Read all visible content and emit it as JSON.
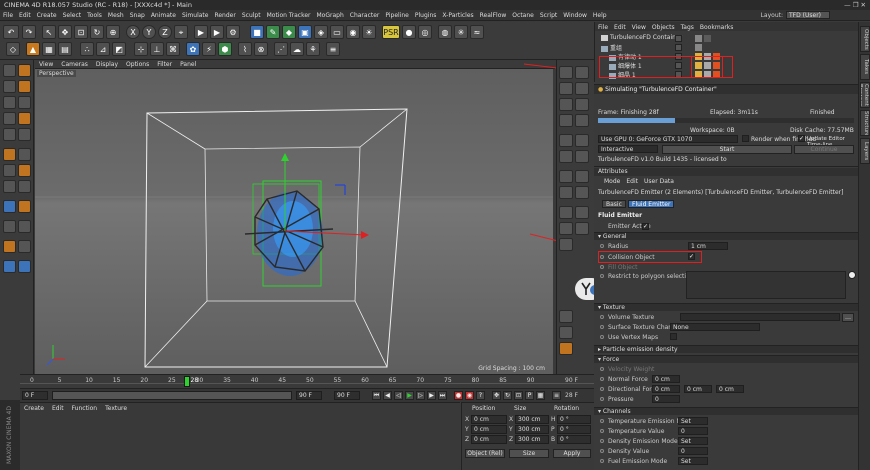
{
  "window": {
    "title": "CINEMA 4D R18.057 Studio (RC - R18) - [XXXc4d *] - Main",
    "controls": "—  ❐  ✕"
  },
  "menu": [
    "File",
    "Edit",
    "Create",
    "Select",
    "Tools",
    "Mesh",
    "Snap",
    "Animate",
    "Simulate",
    "Render",
    "Sculpt",
    "Motion Tracker",
    "MoGraph",
    "Character",
    "Pipeline",
    "Plugins",
    "X-Particles",
    "RealFlow",
    "Octane",
    "Script",
    "Window",
    "Help"
  ],
  "layout": {
    "label": "Layout:",
    "value": "TFD (User)"
  },
  "viewport": {
    "menu": [
      "View",
      "Cameras",
      "Display",
      "Options",
      "Filter",
      "Panel"
    ],
    "label": "Perspective",
    "grid_spacing": "Grid Spacing : 100 cm"
  },
  "timeline": {
    "ticks": [
      "0",
      "5",
      "10",
      "15",
      "20",
      "25",
      "30",
      "35",
      "40",
      "45",
      "50",
      "55",
      "60",
      "65",
      "70",
      "75",
      "80",
      "85",
      "90"
    ],
    "current_marker": "28",
    "end_frame": "90 F",
    "current_frame_display": "28 F",
    "start_field": "0 F",
    "end_field": "90 F",
    "end_field_a": "90 F"
  },
  "materials": {
    "menu": [
      "Create",
      "Edit",
      "Function",
      "Texture"
    ]
  },
  "logo": "MAXON CINEMA 4D",
  "coords": {
    "headers": [
      "Position",
      "Size",
      "Rotation"
    ],
    "rows": [
      {
        "axis": "X",
        "pos": "0 cm",
        "size": "300 cm",
        "rlabel": "H",
        "rot": "0 °"
      },
      {
        "axis": "Y",
        "pos": "0 cm",
        "size": "300 cm",
        "rlabel": "P",
        "rot": "0 °"
      },
      {
        "axis": "Z",
        "pos": "0 cm",
        "size": "300 cm",
        "rlabel": "B",
        "rot": "0 °"
      }
    ],
    "mode": "Object (Rel)",
    "size_mode": "Size",
    "apply": "Apply"
  },
  "objects": {
    "menu": [
      "File",
      "Edit",
      "View",
      "Objects",
      "Tags",
      "Bookmarks"
    ],
    "items": [
      {
        "name": "TurbulenceFD Container",
        "indent": 0
      },
      {
        "name": "重组",
        "indent": 0
      },
      {
        "name": "有律动 1",
        "indent": 1
      },
      {
        "name": "细爆体 1",
        "indent": 1
      },
      {
        "name": "细晶 1",
        "indent": 1
      }
    ]
  },
  "sidetabs": [
    "Objects",
    "Takes",
    "Content Browser",
    "Structure",
    "Layers"
  ],
  "sim": {
    "header": "Simulating \"TurbulenceFD Container\"",
    "frame": "Frame: Finishing 28f",
    "elapsed": "Elapsed: 3m11s",
    "finished": "Finished",
    "progress": 0.3,
    "workspace": "Workspace: 0B",
    "disk_cache": "Disk Cache: 77.57MB",
    "gpu": "Use GPU 0: GeForce GTX 1070",
    "render_when_finished": "Render when finished",
    "update_editor": "Update Editor Time-line",
    "mode": "Interactive",
    "start": "Start",
    "continue": "Continue",
    "version": "TurbulenceFD v1.0 Build 1435 - licensed to"
  },
  "attributes": {
    "header": "Attributes",
    "menu": [
      "Mode",
      "Edit",
      "User Data"
    ],
    "object_line": "TurbulenceFD Emitter (2 Elements) [TurbulenceFD Emitter, TurbulenceFD Emitter]",
    "tabs": [
      "Basic",
      "Fluid Emitter"
    ],
    "section": "Fluid Emitter",
    "emitter_active": "Emitter Active",
    "general": "General",
    "radius_label": "Radius",
    "radius_value": "1 cm",
    "collision_label": "Collision Object",
    "fill_label": "Fill Object",
    "restrict_label": "Restrict to polygon selections",
    "texture_sec": "Texture",
    "vol_texture": "Volume Texture",
    "surf_channel": "Surface Texture Channel",
    "surf_channel_val": "None",
    "use_vertex": "Use Vertex Maps",
    "particle_sec": "Particle emission density",
    "force_sec": "Force",
    "velocity_weight": "Velocity Weight",
    "normal_force": "Normal Force",
    "normal_force_val": "0 cm",
    "directional_force": "Directional Force",
    "dir_x": "0 cm",
    "dir_y": "0 cm",
    "dir_z": "0 cm",
    "pressure": "Pressure",
    "pressure_val": "0",
    "channels_sec": "Channels",
    "channels": [
      {
        "label": "Temperature Emission Mode",
        "value": "Set"
      },
      {
        "label": "Temperature Value",
        "value": "0"
      },
      {
        "label": "Density Emission Mode",
        "value": "Set"
      },
      {
        "label": "Density Value",
        "value": "0"
      },
      {
        "label": "Fuel Emission Mode",
        "value": "Set"
      }
    ]
  }
}
